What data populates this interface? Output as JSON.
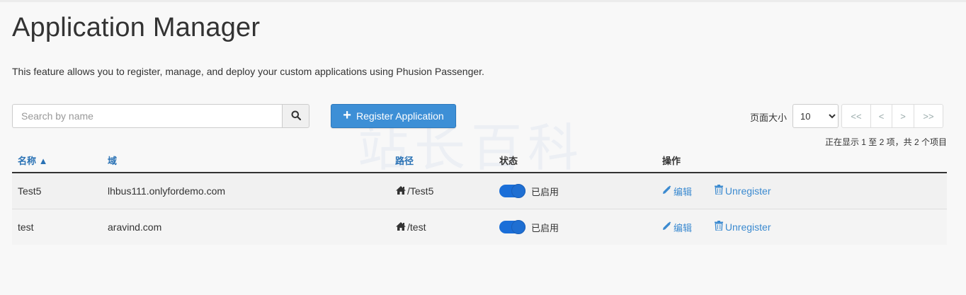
{
  "page": {
    "title": "Application Manager",
    "description": "This feature allows you to register, manage, and deploy your custom applications using Phusion Passenger."
  },
  "search": {
    "placeholder": "Search by name",
    "value": "",
    "icon": "search-icon"
  },
  "register_button": {
    "label": "Register Application",
    "icon": "plus-icon",
    "color": "#3d8fd6"
  },
  "pagination": {
    "page_size_label": "页面大小",
    "page_size": "10",
    "page_size_options": [
      "10"
    ],
    "first": "<<",
    "prev": "<",
    "next": ">",
    "last": ">>",
    "showing_text": "正在显示 1 至 2 项，共 2 个项目"
  },
  "watermark": "站长百科",
  "table": {
    "columns": {
      "name": "名称 ▲",
      "domain": "域",
      "path": "路径",
      "status": "状态",
      "actions": "操作"
    },
    "rows": [
      {
        "name": "Test5",
        "domain": "lhbus111.onlyfordemo.com",
        "path": "/Test5",
        "status": "已启用",
        "enabled": true,
        "edit": "编辑",
        "unregister": "Unregister"
      },
      {
        "name": "test",
        "domain": "aravind.com",
        "path": "/test",
        "status": "已启用",
        "enabled": true,
        "edit": "编辑",
        "unregister": "Unregister"
      }
    ]
  },
  "colors": {
    "link": "#3b8ad0",
    "toggle_on": "#1a6ed8",
    "header_sort": "#2a72b5"
  }
}
